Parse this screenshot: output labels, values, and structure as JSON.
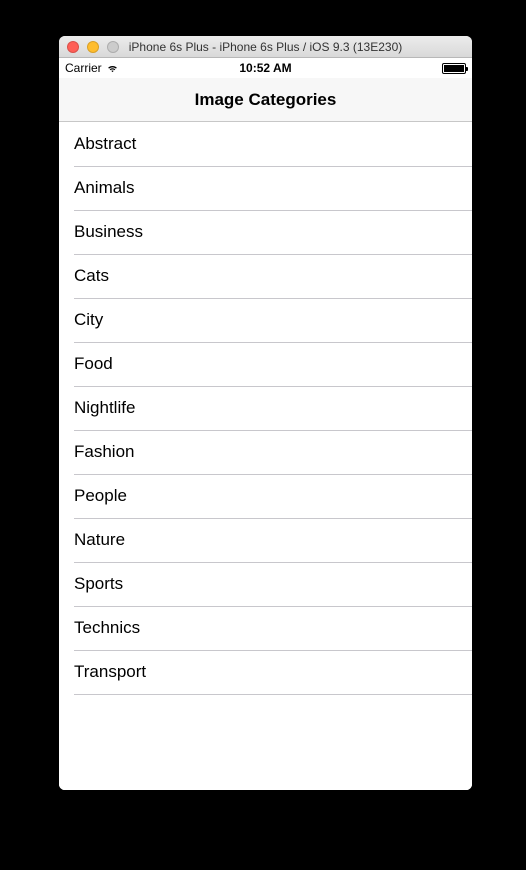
{
  "window": {
    "title": "iPhone 6s Plus - iPhone 6s Plus / iOS 9.3 (13E230)"
  },
  "status_bar": {
    "carrier": "Carrier",
    "time": "10:52 AM"
  },
  "nav": {
    "title": "Image Categories"
  },
  "categories": [
    "Abstract",
    "Animals",
    "Business",
    "Cats",
    "City",
    "Food",
    "Nightlife",
    "Fashion",
    "People",
    "Nature",
    "Sports",
    "Technics",
    "Transport"
  ]
}
